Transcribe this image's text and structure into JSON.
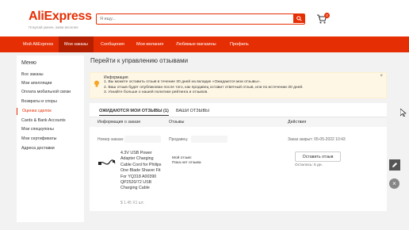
{
  "header": {
    "logo": "AliExpress",
    "tagline": "Покупай умнее, живи веселее",
    "search_placeholder": "Я ищу...",
    "cart_count": "0"
  },
  "nav": {
    "items": [
      {
        "label": "Мой AliExpress"
      },
      {
        "label": "Мои заказы"
      },
      {
        "label": "Сообщения"
      },
      {
        "label": "Мои желания"
      },
      {
        "label": "Любимые магазины"
      },
      {
        "label": "Профиль"
      }
    ],
    "active_index": 1
  },
  "sidebar": {
    "title": "Меню",
    "items": [
      {
        "label": "Все заказы"
      },
      {
        "label": "Мои апелляции"
      },
      {
        "label": "Оплата мобильной связи"
      },
      {
        "label": "Возвраты и споры"
      },
      {
        "label": "Оценка сделок"
      },
      {
        "label": "Cards & Bank Accounts"
      },
      {
        "label": "Мои спецкупоны"
      },
      {
        "label": "Мои сертификаты"
      },
      {
        "label": "Адреса доставки"
      }
    ],
    "active_index": 4
  },
  "main": {
    "title": "Перейти к управлению отзывами",
    "info": {
      "title": "Информация",
      "lines": [
        "1. Вы можете оставить отзыв в течение 30 дней на вкладке «Ожидаются мои отзывы».",
        "2. Ваш отзыв будет опубликован после того, как продавец оставит ответный отзыв, или по истечении 30 дней.",
        "3. Узнайте больше о нашей политике рейтинга и отзывов."
      ]
    },
    "tabs": [
      {
        "label": "ОЖИДАЮТСЯ МОИ ОТЗЫВЫ (1)"
      },
      {
        "label": "ВАШИ ОТЗЫВЫ"
      }
    ],
    "columns": {
      "order": "Информация о заказе",
      "reviews": "Отзывы",
      "actions": "Действия"
    },
    "filter": {
      "order_label": "Номер заказа:",
      "seller_label": "Продавец:",
      "deadline": "Заказ закрыт: 05-05-2022 10:43"
    },
    "order": {
      "product": "4.3V USB Power Adapter Charging Cable Cord for Philips One Blade Shaver Fit For YQ318 A00390 QP2520/72 USB Charging Cable",
      "price": "$ 1.45 X1 шт.",
      "my_review_label": "Мой отзыв:",
      "my_review_value": "Пока нет отзыва",
      "leave_button": "Оставить отзыв",
      "days_left": "Осталось: 5 дн."
    }
  },
  "colors": {
    "brand": "#e62e04",
    "nav_active": "#b41f00",
    "info_bg": "#fff7e6",
    "bulb": "#f5a623"
  }
}
